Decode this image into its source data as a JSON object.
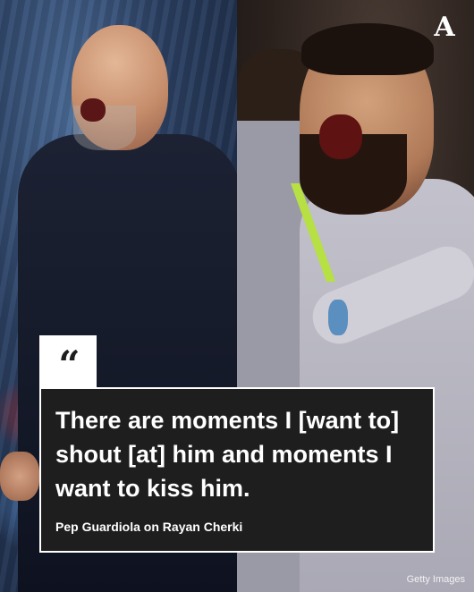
{
  "brand": {
    "logo_letter": "A"
  },
  "quote": {
    "icon": "quote-mark-icon",
    "icon_glyph": "“",
    "text": "There are moments I [want to] shout [at] him and moments I want to kiss him.",
    "attribution": "Pep Guardiola on Rayan Cherki"
  },
  "credit": "Getty Images",
  "colors": {
    "quote_bg": "#1e1e1e",
    "quote_text": "#ffffff",
    "kit_accent": "#b6e043"
  }
}
